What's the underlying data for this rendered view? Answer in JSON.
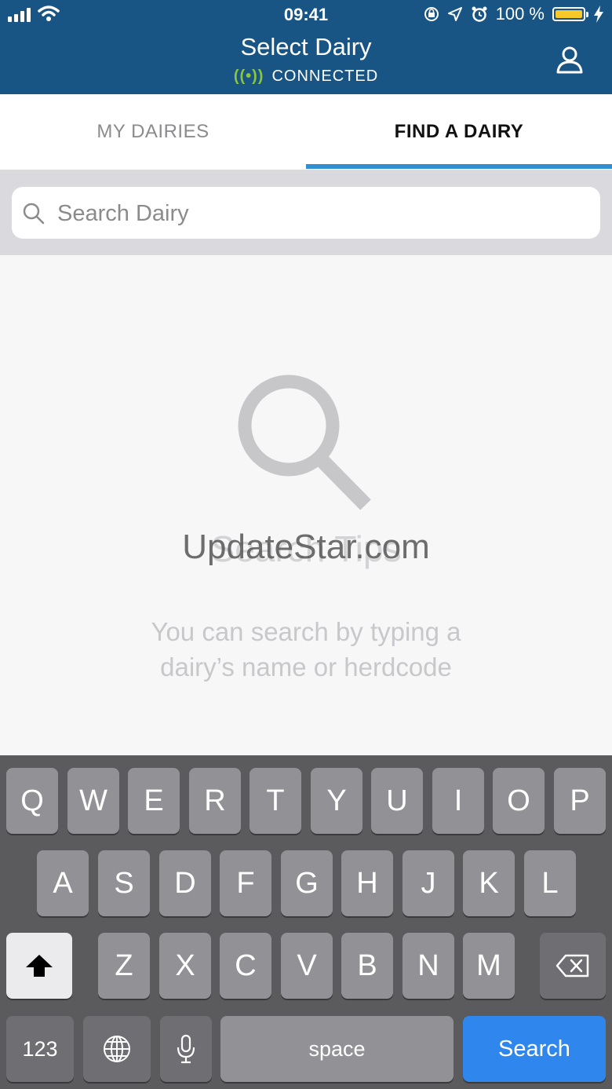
{
  "status_bar": {
    "time": "09:41",
    "battery_percent": "100 %"
  },
  "header": {
    "title": "Select Dairy",
    "connection_status": "CONNECTED"
  },
  "tabs": [
    {
      "label": "MY DAIRIES",
      "active": false
    },
    {
      "label": "FIND A DAIRY",
      "active": true
    }
  ],
  "search": {
    "placeholder": "Search Dairy",
    "value": ""
  },
  "empty_state": {
    "title": "Search Tips",
    "line1": "You can search by typing a",
    "line2": "dairy’s name or herdcode"
  },
  "watermark": "UpdateStar.com",
  "keyboard": {
    "row1": [
      "Q",
      "W",
      "E",
      "R",
      "T",
      "Y",
      "U",
      "I",
      "O",
      "P"
    ],
    "row2": [
      "A",
      "S",
      "D",
      "F",
      "G",
      "H",
      "J",
      "K",
      "L"
    ],
    "row3": [
      "Z",
      "X",
      "C",
      "V",
      "B",
      "N",
      "M"
    ],
    "numbers_label": "123",
    "space_label": "space",
    "return_label": "Search"
  },
  "colors": {
    "header_bg": "#185584",
    "accent": "#2f8fd1",
    "connected": "#8cc63f",
    "return_key": "#2f87ee"
  }
}
